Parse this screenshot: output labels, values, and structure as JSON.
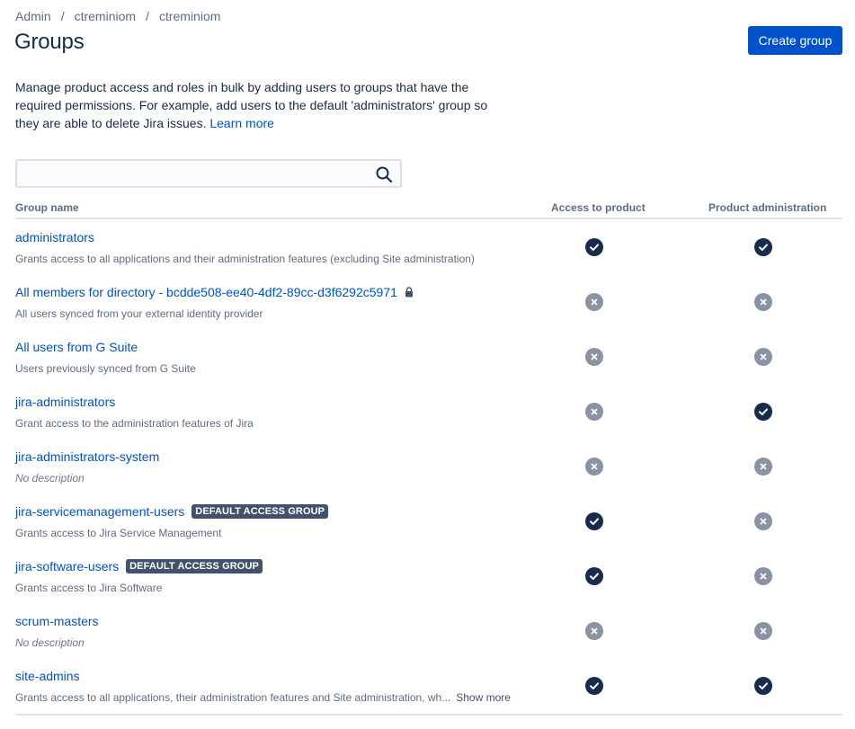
{
  "breadcrumb": [
    "Admin",
    "ctreminiom",
    "ctreminiom"
  ],
  "breadcrumb_separator": "/",
  "title": "Groups",
  "create_button": "Create group",
  "intro": {
    "text": "Manage product access and roles in bulk by adding users to groups that have the required permissions. For example, add users to the default 'administrators' group so they are able to delete Jira issues.",
    "link": "Learn more"
  },
  "search": {
    "value": "",
    "placeholder": ""
  },
  "columns": {
    "name": "Group name",
    "access": "Access to product",
    "admin": "Product administration"
  },
  "icons": {
    "granted": "check-circle-icon",
    "denied": "cross-circle-icon",
    "search": "search-icon",
    "lock": "lock-icon"
  },
  "colors": {
    "granted": "#172b4d",
    "denied": "#8993a4",
    "link": "#0052cc",
    "primary_button": "#0052cc",
    "badge": "#42526e"
  },
  "groups": [
    {
      "name": "administrators",
      "description": "Grants access to all applications and their administration features (excluding Site administration)",
      "access": true,
      "admin": true
    },
    {
      "name": "All members for directory - bcdde508-ee40-4df2-89cc-d3f6292c5971",
      "locked": true,
      "description": "All users synced from your external identity provider",
      "access": false,
      "admin": false
    },
    {
      "name": "All users from G Suite",
      "description": "Users previously synced from G Suite",
      "access": false,
      "admin": false
    },
    {
      "name": "jira-administrators",
      "description": "Grant access to the administration features of Jira",
      "access": false,
      "admin": true
    },
    {
      "name": "jira-administrators-system",
      "description": "No description",
      "empty": true,
      "access": false,
      "admin": false
    },
    {
      "name": "jira-servicemanagement-users",
      "badge": "DEFAULT ACCESS GROUP",
      "description": "Grants access to Jira Service Management",
      "access": true,
      "admin": false
    },
    {
      "name": "jira-software-users",
      "badge": "DEFAULT ACCESS GROUP",
      "description": "Grants access to Jira Software",
      "access": true,
      "admin": false
    },
    {
      "name": "scrum-masters",
      "description": "No description",
      "empty": true,
      "access": false,
      "admin": false
    },
    {
      "name": "site-admins",
      "description": "Grants access to all applications, their administration features and Site administration, wh...",
      "show_more": "Show more",
      "access": true,
      "admin": true
    }
  ]
}
